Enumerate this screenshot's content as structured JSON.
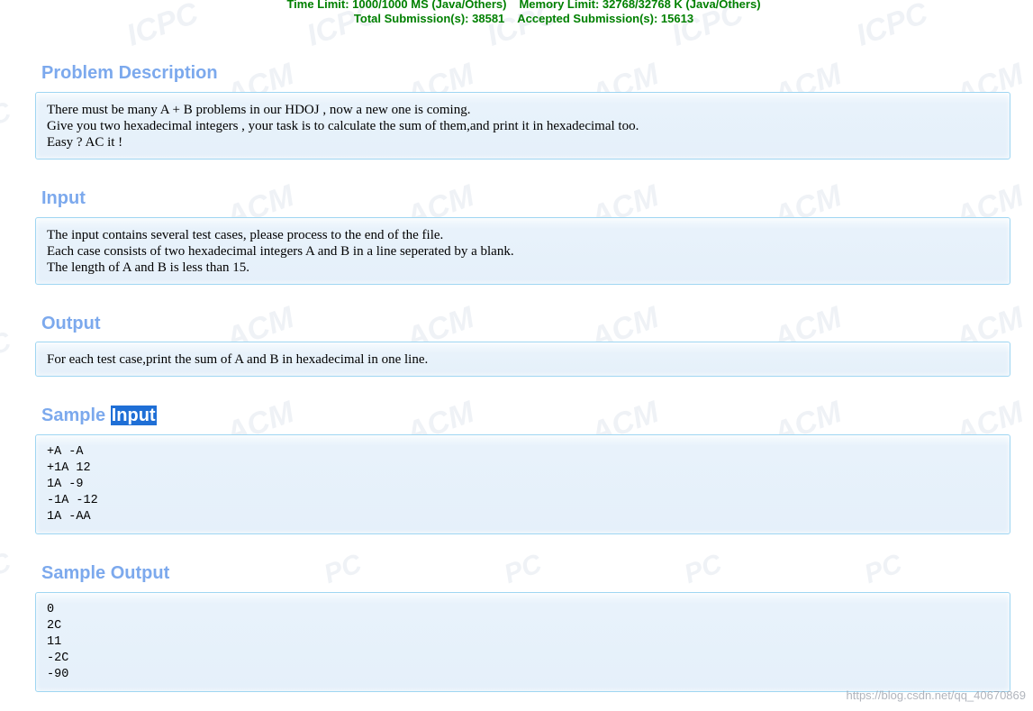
{
  "header": {
    "time_limit": "Time Limit: 1000/1000 MS (Java/Others)",
    "memory_limit": "Memory Limit: 32768/32768 K (Java/Others)",
    "total_submissions": "Total Submission(s): 38581",
    "accepted_submissions": "Accepted Submission(s): 15613"
  },
  "sections": {
    "description": {
      "title": "Problem Description",
      "lines": [
        "There must be many A + B problems in our HDOJ , now a new one is coming.",
        "Give you two hexadecimal integers , your task is to calculate the sum of them,and print it in hexadecimal too.",
        "Easy ? AC it !"
      ]
    },
    "input": {
      "title": "Input",
      "lines": [
        "The input contains several test cases, please process to the end of the file.",
        "Each case consists of two hexadecimal integers A and B in a line seperated by a blank.",
        "The length of A and B is less than 15."
      ]
    },
    "output": {
      "title": "Output",
      "lines": [
        "For each test case,print the sum of A and B in hexadecimal in one line."
      ]
    },
    "sample_input": {
      "title_prefix": "Sample",
      "title_highlight": "Input",
      "lines": [
        "+A -A",
        "+1A 12",
        "1A -9",
        "-1A -12",
        "1A -AA"
      ]
    },
    "sample_output": {
      "title": "Sample Output",
      "lines": [
        "0",
        "2C",
        "11",
        "-2C",
        "-90"
      ]
    }
  },
  "watermark_url": "https://blog.csdn.net/qq_40670869",
  "colors": {
    "header_green": "#008000",
    "title_blue": "#7ca9ed",
    "highlight_bg": "#1f6fd6",
    "panel_border": "#9fd6f2",
    "panel_bg": "#e5f0fa"
  }
}
